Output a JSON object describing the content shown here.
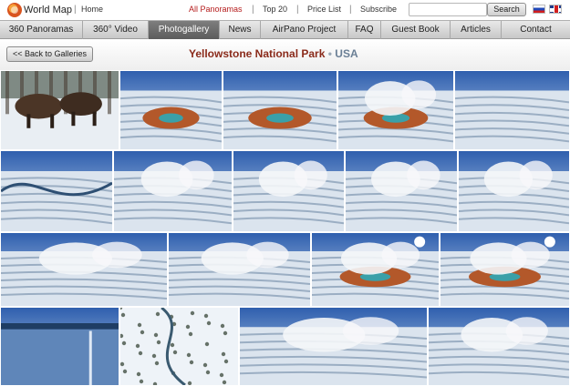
{
  "header": {
    "logo_text": "World Map",
    "links": {
      "home": "Home",
      "all_panoramas": "All Panoramas",
      "top20": "Top 20",
      "price_list": "Price List",
      "subscribe": "Subscribe"
    },
    "search": {
      "value": "",
      "placeholder": "",
      "button_label": "Search"
    },
    "languages": [
      "Russian",
      "English"
    ]
  },
  "nav": {
    "items": [
      {
        "label": "360 Panoramas"
      },
      {
        "label": "360° Video"
      },
      {
        "label": "Photogallery"
      },
      {
        "label": "News"
      },
      {
        "label": "AirPano Project"
      },
      {
        "label": "FAQ"
      },
      {
        "label": "Guest Book"
      },
      {
        "label": "Articles"
      },
      {
        "label": "Contact"
      }
    ],
    "active": "Photogallery"
  },
  "gallery": {
    "back_label": "<< Back to Galleries",
    "title_park": "Yellowstone National Park",
    "title_separator": "•",
    "title_country": "USA",
    "thumbnails": [
      {
        "scene": "bison-in-snow"
      },
      {
        "scene": "aerial-hot-spring-snow"
      },
      {
        "scene": "aerial-hot-spring-snow"
      },
      {
        "scene": "grand-prismatic-spring-steam"
      },
      {
        "scene": "aerial-snowy-valley"
      },
      {
        "scene": "aerial-winding-river"
      },
      {
        "scene": "aerial-steam-geysers"
      },
      {
        "scene": "aerial-steam-geysers"
      },
      {
        "scene": "aerial-steam-geysers"
      },
      {
        "scene": "aerial-steam-geysers"
      },
      {
        "scene": "aerial-steam-basin"
      },
      {
        "scene": "aerial-steam-basin"
      },
      {
        "scene": "grand-prismatic-sunburst"
      },
      {
        "scene": "grand-prismatic-sunburst"
      },
      {
        "scene": "frozen-lake"
      },
      {
        "scene": "snowy-river-forest"
      },
      {
        "scene": "aerial-steam-geysers"
      },
      {
        "scene": "aerial-steam-geysers"
      }
    ]
  },
  "colors": {
    "active_link": "#b51c1c",
    "title_park": "#8a2a1a",
    "title_country": "#6a7f95",
    "nav_active_bg": "#6a6a6a"
  }
}
